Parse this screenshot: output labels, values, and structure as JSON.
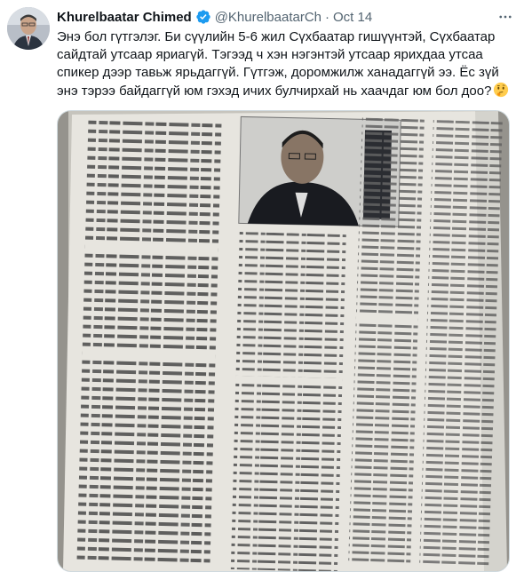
{
  "tweet": {
    "author_name": "Khurelbaatar Chimed",
    "handle": "@KhurelbaatarCh",
    "separator": "·",
    "date": "Oct 14",
    "text": "Энэ бол гүтгэлэг. Би сүүлийн 5-6 жил Сүхбаатар гишүүнтэй, Сүхбаатар сайдтай утсаар яриагүй. Тэгээд ч хэн нэгэнтэй утсаар ярихдаа утсаа спикер дээр тавьж ярьдаггүй. Гүтгэж, доромжилж ханадаггүй ээ. Ёс зүй энэ тэрээ байдаггүй юм гэхэд ичих булчирхай нь хаачдаг юм бол доо?",
    "emoji": "thinking-face-icon",
    "more_icon": "more-options-icon",
    "verified_icon": "verified-badge-icon"
  },
  "colors": {
    "text": "#0f1419",
    "secondary": "#536471",
    "verified": "#1d9bf0",
    "border": "#cfd9de"
  }
}
